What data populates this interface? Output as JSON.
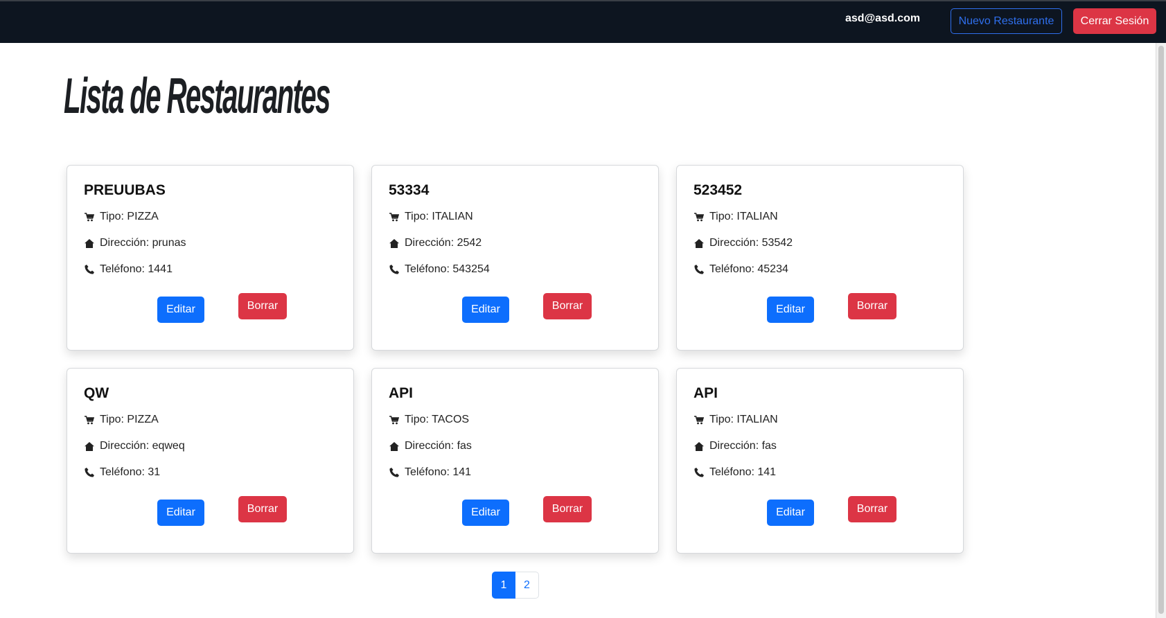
{
  "header": {
    "user_email": "asd@asd.com",
    "new_restaurant_label": "Nuevo Restaurante",
    "logout_label": "Cerrar Sesión"
  },
  "page": {
    "title": "Lista de Restaurantes"
  },
  "restaurants": [
    {
      "name": "PREUUBAS",
      "tipo": "Tipo: PIZZA",
      "direccion": "Dirección: prunas",
      "telefono": "Teléfono: 1441",
      "edit_label": "Editar",
      "delete_label": "Borrar"
    },
    {
      "name": "53334",
      "tipo": "Tipo: ITALIAN",
      "direccion": "Dirección: 2542",
      "telefono": "Teléfono: 543254",
      "edit_label": "Editar",
      "delete_label": "Borrar"
    },
    {
      "name": "523452",
      "tipo": "Tipo: ITALIAN",
      "direccion": "Dirección: 53542",
      "telefono": "Teléfono: 45234",
      "edit_label": "Editar",
      "delete_label": "Borrar"
    },
    {
      "name": "QW",
      "tipo": "Tipo: PIZZA",
      "direccion": "Dirección: eqweq",
      "telefono": "Teléfono: 31",
      "edit_label": "Editar",
      "delete_label": "Borrar"
    },
    {
      "name": "API",
      "tipo": "Tipo: TACOS",
      "direccion": "Dirección: fas",
      "telefono": "Teléfono: 141",
      "edit_label": "Editar",
      "delete_label": "Borrar"
    },
    {
      "name": "API",
      "tipo": "Tipo: ITALIAN",
      "direccion": "Dirección: fas",
      "telefono": "Teléfono: 141",
      "edit_label": "Editar",
      "delete_label": "Borrar"
    }
  ],
  "pagination": {
    "pages": [
      "1",
      "2"
    ],
    "current": "1"
  },
  "icons": {
    "tipo": "cart-icon",
    "direccion": "house-icon",
    "telefono": "phone-icon"
  },
  "colors": {
    "navbar": "#0d1520",
    "primary": "#0d6efd",
    "danger": "#dc3545",
    "outline": "#2f6fed"
  }
}
